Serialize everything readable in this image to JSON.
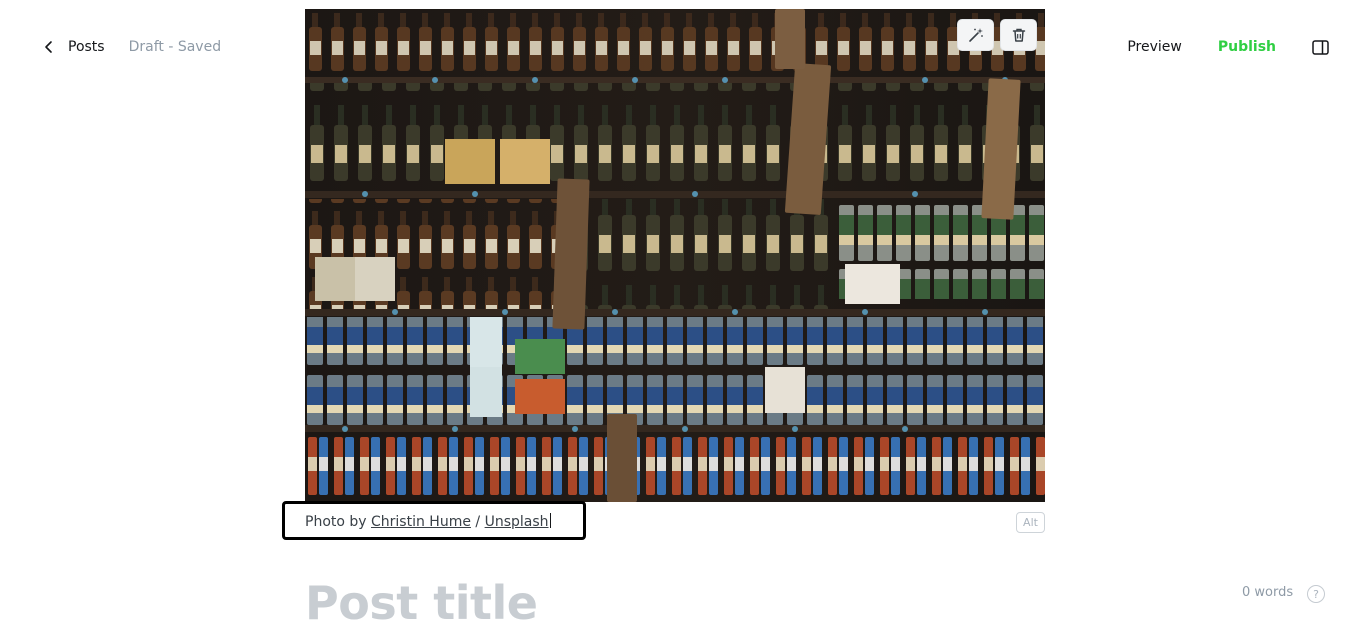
{
  "header": {
    "back_label": "Posts",
    "status": "Draft - Saved",
    "preview_label": "Preview",
    "publish_label": "Publish",
    "publish_color": "#30cf43"
  },
  "icons": {
    "back": "chevron-left-icon",
    "sidebar": "sidebar-panel-icon",
    "magic": "magic-wand-icon",
    "delete": "trash-icon",
    "help": "question-circle-icon"
  },
  "image_card": {
    "alt_label": "Alt",
    "caption": {
      "prefix": "Photo by ",
      "author": "Christin Hume",
      "separator": " / ",
      "source": "Unsplash"
    }
  },
  "editor": {
    "title_placeholder": "Post title",
    "word_count": "0 words",
    "help_label": "?"
  }
}
